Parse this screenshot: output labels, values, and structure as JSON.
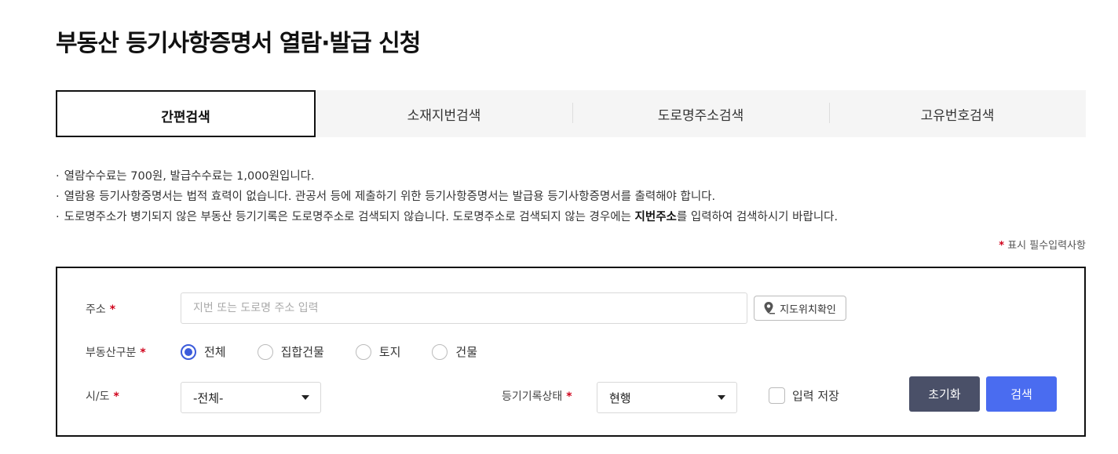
{
  "page": {
    "title": "부동산 등기사항증명서 열람·발급 신청"
  },
  "tabs": [
    {
      "label": "간편검색",
      "active": true
    },
    {
      "label": "소재지번검색",
      "active": false
    },
    {
      "label": "도로명주소검색",
      "active": false
    },
    {
      "label": "고유번호검색",
      "active": false
    }
  ],
  "notices": {
    "line1": "열람수수료는  700원, 발급수수료는  1,000원입니다.",
    "line2": "열람용 등기사항증명서는 법적 효력이 없습니다. 관공서 등에 제출하기 위한 등기사항증명서는 발급용 등기사항증명서를 출력해야 합니다.",
    "line3_pre": "도로명주소가 병기되지 않은 부동산 등기기록은 도로명주소로 검색되지 않습니다. 도로명주소로 검색되지 않는 경우에는 ",
    "line3_bold": "지번주소",
    "line3_post": "를 입력하여 검색하시기 바랍니다.",
    "bullet": "·"
  },
  "required_legend": {
    "star": "*",
    "text": "표시 필수입력사항"
  },
  "form": {
    "address": {
      "label": "주소",
      "star": "*",
      "placeholder": "지번 또는 도로명 주소 입력",
      "value": "",
      "map_button_label": "지도위치확인",
      "map_icon": "map-pin-icon"
    },
    "property_type": {
      "label": "부동산구분",
      "star": "*",
      "options": [
        {
          "label": "전체",
          "checked": true
        },
        {
          "label": "집합건물",
          "checked": false
        },
        {
          "label": "토지",
          "checked": false
        },
        {
          "label": "건물",
          "checked": false
        }
      ]
    },
    "region": {
      "label": "시/도",
      "star": "*",
      "selected": "-전체-"
    },
    "record_status": {
      "label": "등기기록상태",
      "star": "*",
      "selected": "현행"
    },
    "save_input": {
      "label": "입력 저장",
      "checked": false
    },
    "buttons": {
      "reset": "초기화",
      "search": "검색"
    }
  },
  "colors": {
    "accent_blue": "#4a6cf0",
    "radio_blue": "#3b5bdb",
    "reset_gray": "#4a5068",
    "required_red": "#d0021b"
  }
}
